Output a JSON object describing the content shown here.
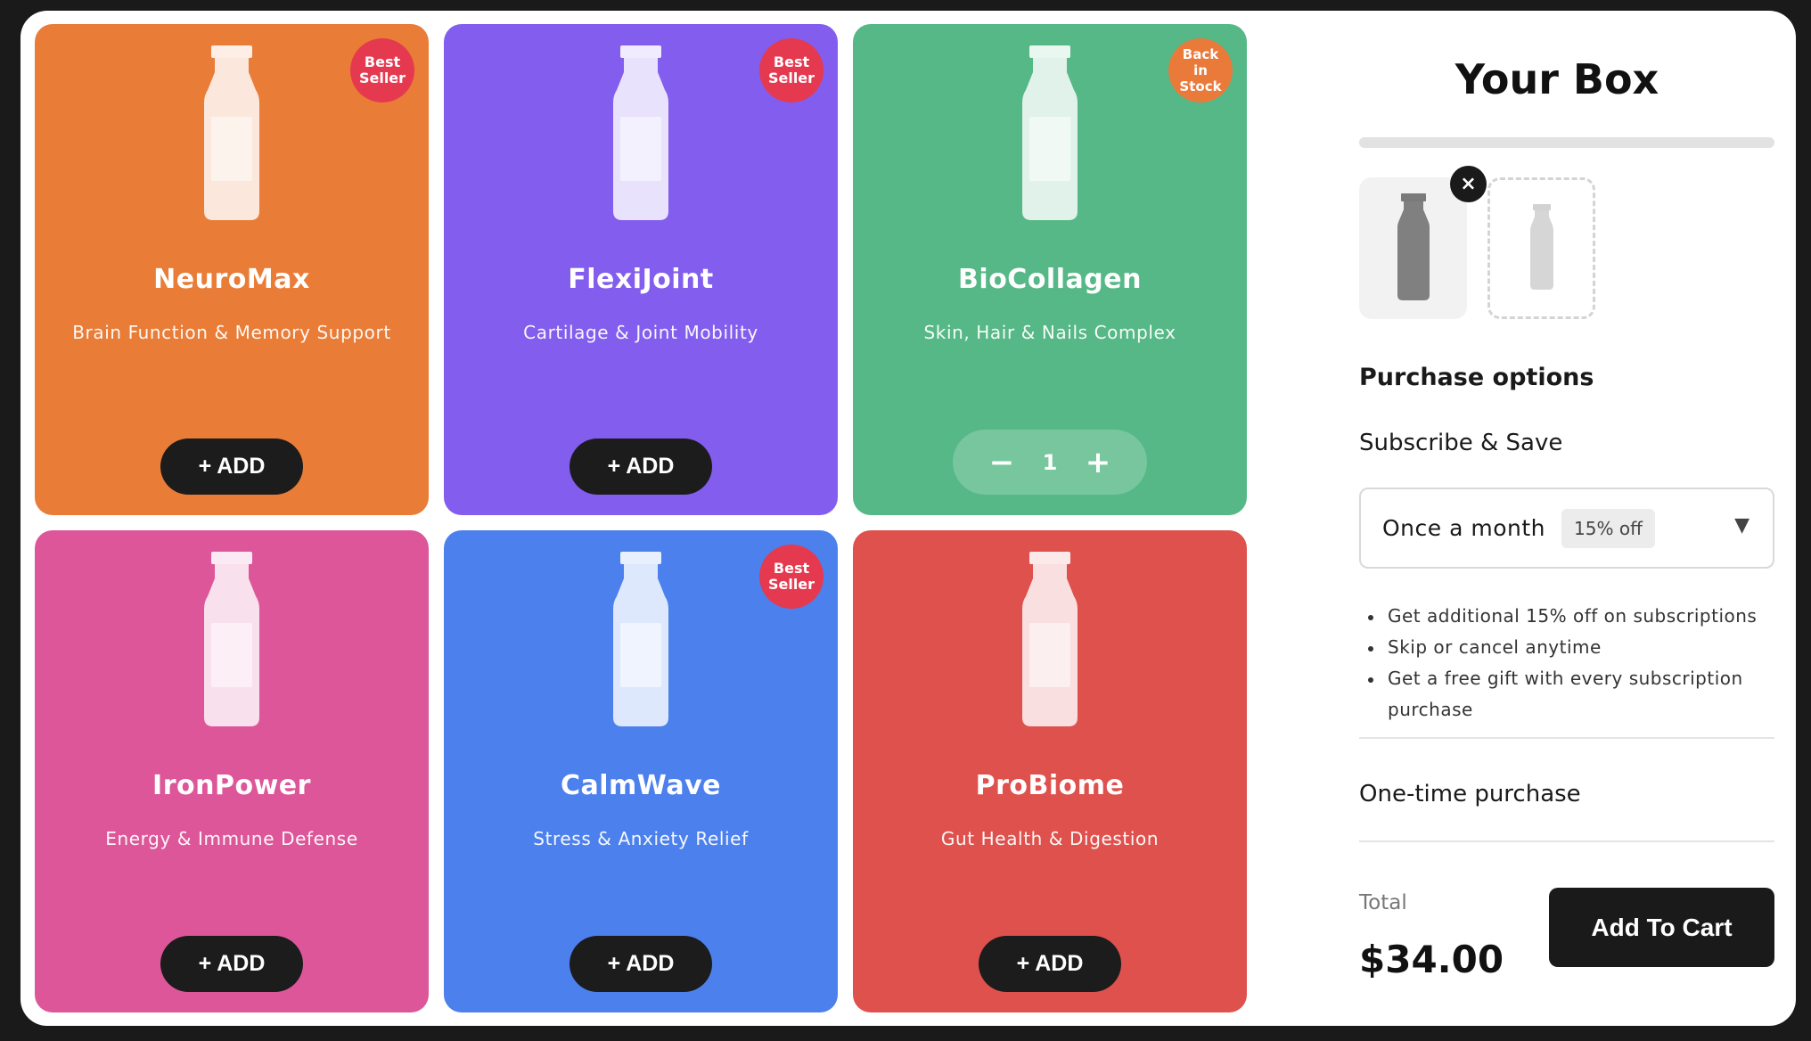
{
  "products": [
    {
      "name": "NeuroMax",
      "subtitle": "Brain Function & Memory Support",
      "badge": "Best Seller",
      "color": "#e97c37",
      "button": "+ ADD"
    },
    {
      "name": "FlexiJoint",
      "subtitle": "Cartilage & Joint Mobility",
      "badge": "Best Seller",
      "color": "#835ded",
      "button": "+ ADD"
    },
    {
      "name": "BioCollagen",
      "subtitle": "Skin, Hair & Nails Complex",
      "badge": "Back in Stock",
      "color": "#55b886",
      "quantity": "1",
      "minus": "−",
      "plus": "+"
    },
    {
      "name": "IronPower",
      "subtitle": "Energy & Immune Defense",
      "badge": "",
      "color": "#dd5699",
      "button": "+ ADD"
    },
    {
      "name": "CalmWave",
      "subtitle": "Stress & Anxiety Relief",
      "badge": "Best Seller",
      "color": "#4c80ec",
      "button": "+ ADD"
    },
    {
      "name": "ProBiome",
      "subtitle": "Gut Health & Digestion",
      "badge": "",
      "color": "#de514d",
      "button": "+ ADD"
    }
  ],
  "box": {
    "title": "Your Box",
    "progress_fraction": 0,
    "remove_label": "×",
    "purchase_options_title": "Purchase options",
    "subscribe_label": "Subscribe & Save",
    "frequency": {
      "value": "Once a month",
      "discount": "15% off",
      "caret": "▼"
    },
    "benefits": [
      "Get additional 15% off on subscriptions",
      "Skip or cancel anytime",
      "Get a free gift with every subscription purchase"
    ],
    "one_time_label": "One-time purchase",
    "total_label": "Total",
    "total_value": "$34.00",
    "cart_button": "Add To Cart"
  }
}
